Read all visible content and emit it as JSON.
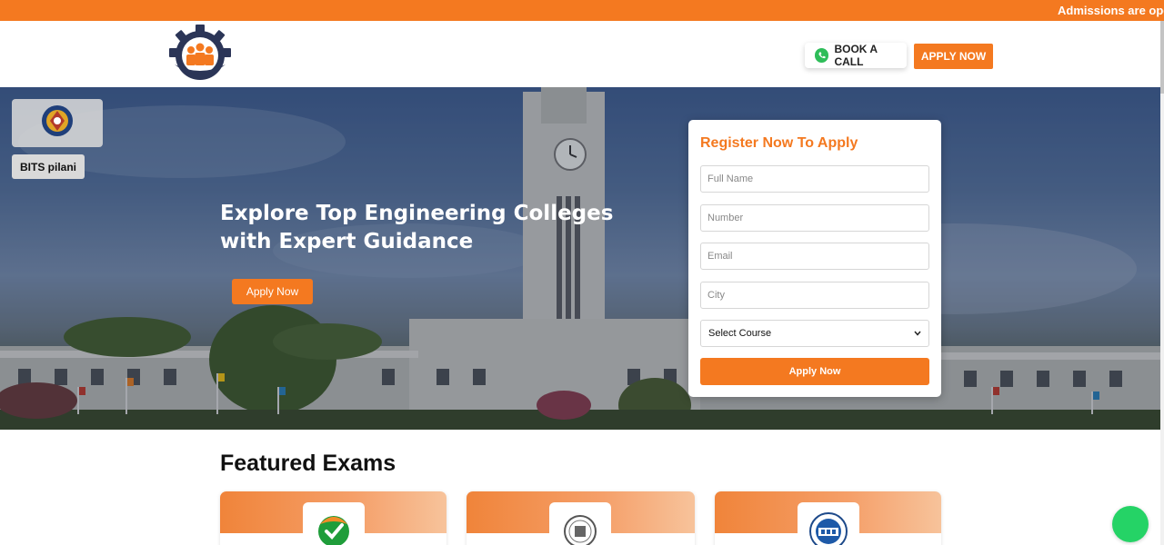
{
  "ticker": {
    "text": "Admissions are ope"
  },
  "header": {
    "logo_icon": "graduation-gear-logo",
    "book_call_label": "BOOK A CALL",
    "book_call_icon": "phone-icon",
    "apply_label": "APPLY NOW"
  },
  "hero": {
    "college_name": "BITS pilani",
    "college_logo_icon": "bits-pilani-crest-icon",
    "title_line1": "Explore Top Engineering Colleges",
    "title_line2": "with Expert Guidance",
    "cta_label": "Apply Now"
  },
  "form": {
    "title": "Register Now To Apply",
    "full_name_placeholder": "Full Name",
    "number_placeholder": "Number",
    "email_placeholder": "Email",
    "city_placeholder": "City",
    "course_selected": "Select Course",
    "submit_label": "Apply Now"
  },
  "featured": {
    "heading": "Featured Exams",
    "cards": [
      {
        "icon": "checkmark-badge-icon"
      },
      {
        "icon": "seal-emblem-icon"
      },
      {
        "icon": "cet-logo-icon"
      }
    ]
  },
  "colors": {
    "brand_orange": "#f47920",
    "navy": "#2b3557",
    "whatsapp_green": "#25d366"
  }
}
